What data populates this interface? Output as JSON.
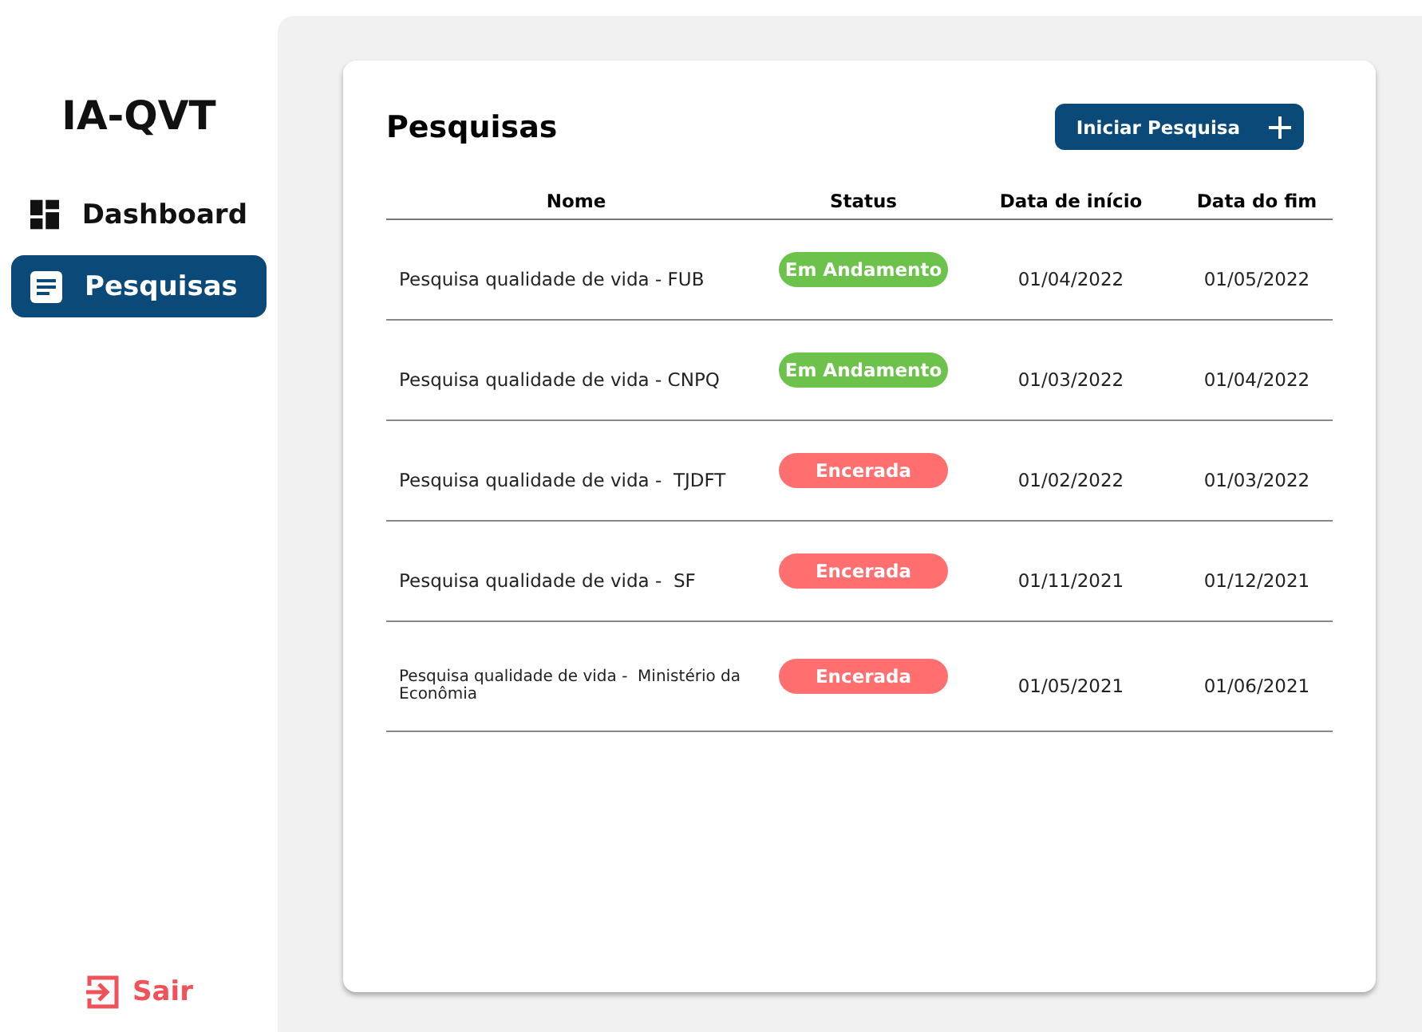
{
  "sidebar": {
    "logo": "IA-QVT",
    "items": [
      {
        "label": "Dashboard",
        "kind": "grid",
        "selected": false
      },
      {
        "label": "Pesquisas",
        "kind": "doc",
        "selected": true
      }
    ],
    "logout": "Sair"
  },
  "card": {
    "title": "Pesquisas",
    "button": "Iniciar Pesquisa",
    "columns": [
      "Nome",
      "Status",
      "Data de início",
      "Data do fim"
    ],
    "rows": [
      {
        "name": "Pesquisa qualidade de vida - FUB",
        "status": "Em Andamento",
        "kind": "active",
        "start": "01/04/2022",
        "end": "01/05/2022"
      },
      {
        "name": "Pesquisa qualidade de vida - CNPQ",
        "status": "Em Andamento",
        "kind": "active",
        "start": "01/03/2022",
        "end": "01/04/2022"
      },
      {
        "name": "Pesquisa qualidade de vida -  TJDFT",
        "status": "Encerada",
        "kind": "closed",
        "start": "01/02/2022",
        "end": "01/03/2022"
      },
      {
        "name": "Pesquisa qualidade de vida -  SF",
        "status": "Encerada",
        "kind": "closed",
        "start": "01/11/2021",
        "end": "01/12/2021"
      },
      {
        "name": "Pesquisa qualidade de vida -  Ministério da Econômia",
        "status": "Encerada",
        "kind": "closed",
        "start": "01/05/2021",
        "end": "01/06/2021"
      }
    ]
  }
}
